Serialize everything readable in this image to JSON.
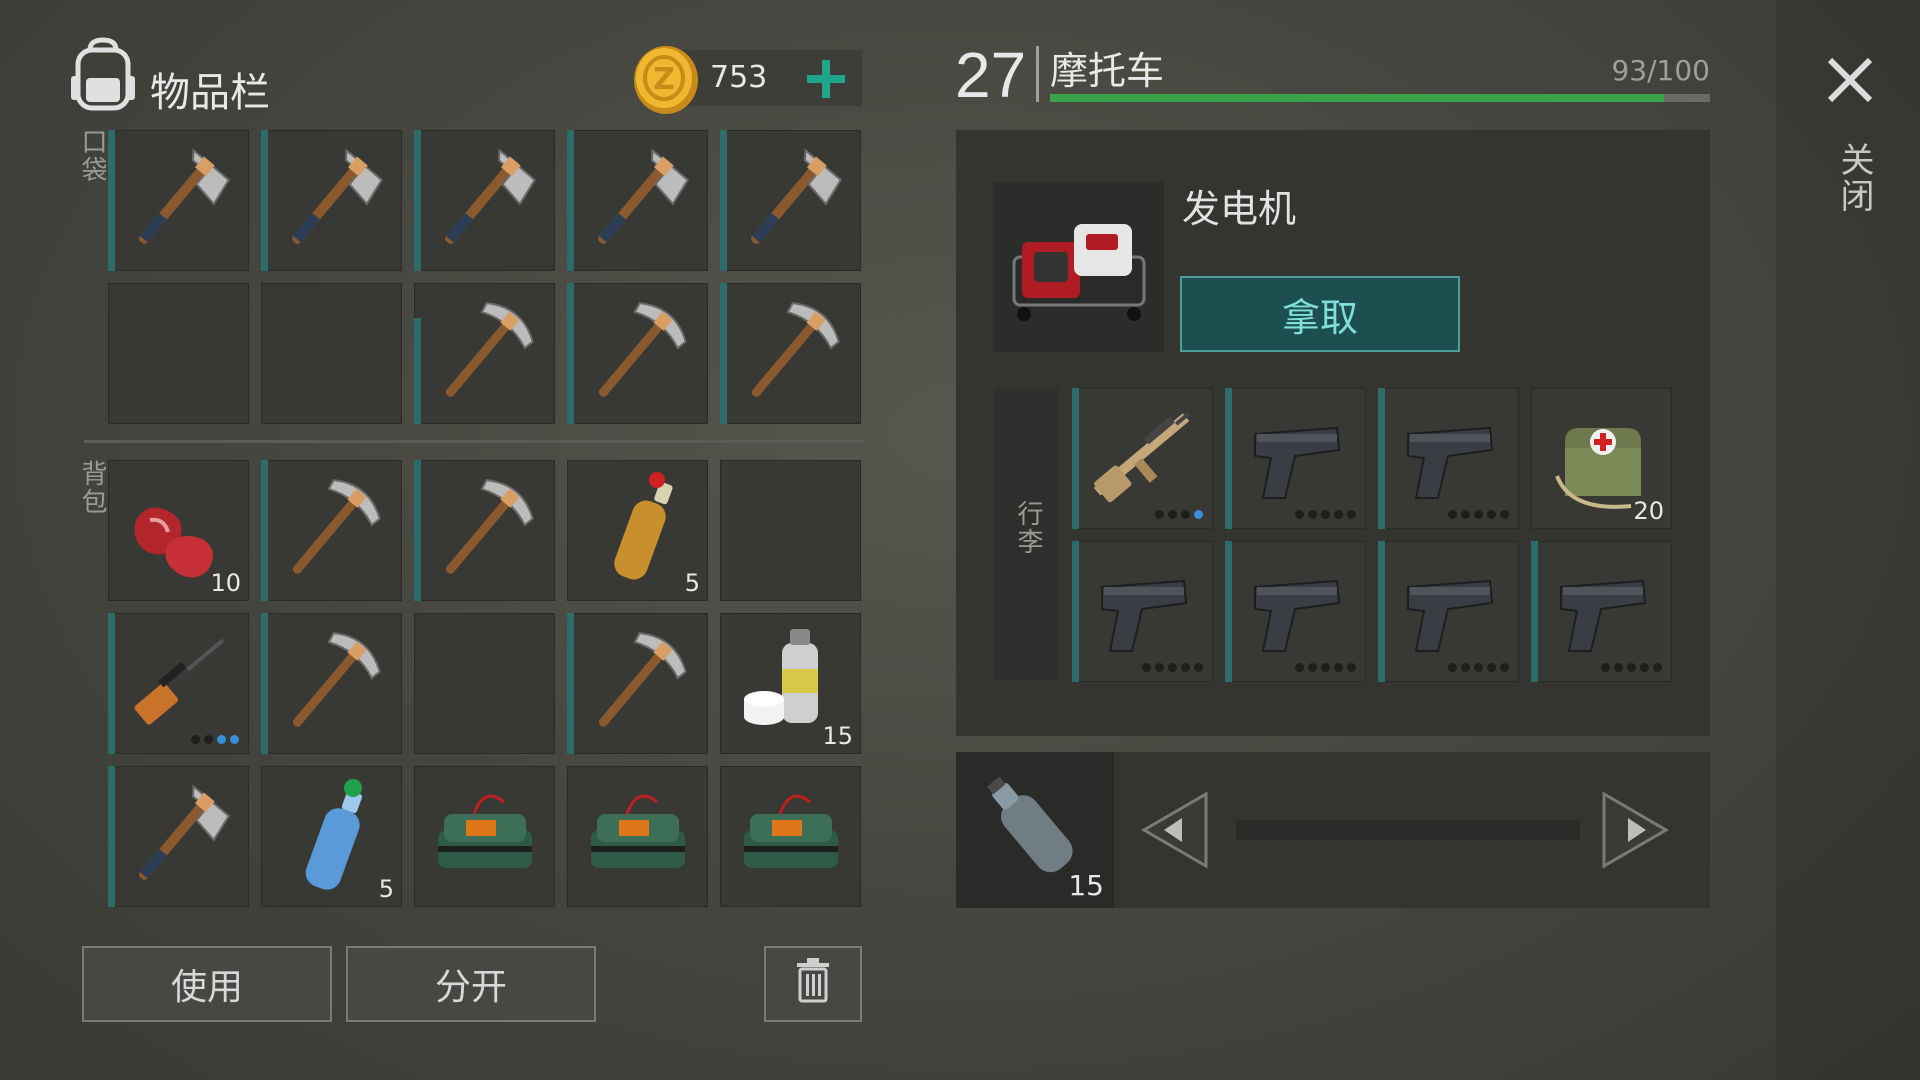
{
  "inventory": {
    "title": "物品栏",
    "backpack_icon": "backpack-icon",
    "currency": {
      "icon": "coin-icon",
      "amount": "753",
      "add_icon": "plus-icon"
    },
    "pockets_label": "口袋",
    "bag_label": "背包",
    "pocket_slots": [
      {
        "item": "hatchet-icon",
        "durability": 1.0
      },
      {
        "item": "hatchet-icon",
        "durability": 1.0
      },
      {
        "item": "hatchet-icon",
        "durability": 1.0
      },
      {
        "item": "hatchet-icon",
        "durability": 1.0
      },
      {
        "item": "hatchet-icon",
        "durability": 1.0
      },
      {
        "item": "",
        "durability": 0
      },
      {
        "item": "",
        "durability": 0
      },
      {
        "item": "pickaxe-icon",
        "durability": 0.75
      },
      {
        "item": "pickaxe-icon",
        "durability": 1.0
      },
      {
        "item": "pickaxe-icon",
        "durability": 1.0
      }
    ],
    "bag_slots": [
      {
        "item": "raw-meat-icon",
        "count": "10"
      },
      {
        "item": "pickaxe-icon",
        "durability": 1.0
      },
      {
        "item": "pickaxe-icon",
        "durability": 1.0
      },
      {
        "item": "fuel-bottle-icon",
        "count": "5"
      },
      {
        "item": ""
      },
      {
        "item": "sniper-rifle-icon",
        "durability": 1.0,
        "dots": [
          0,
          0,
          1,
          1
        ]
      },
      {
        "item": "pickaxe-icon",
        "durability": 1.0
      },
      {
        "item": ""
      },
      {
        "item": "pickaxe-icon",
        "durability": 1.0
      },
      {
        "item": "spray-paint-icon",
        "count": "15"
      },
      {
        "item": "hatchet-icon",
        "durability": 1.0
      },
      {
        "item": "water-bottle-icon",
        "count": "5"
      },
      {
        "item": "c4-explosive-icon"
      },
      {
        "item": "c4-explosive-icon"
      },
      {
        "item": "c4-explosive-icon"
      }
    ],
    "use_label": "使用",
    "split_label": "分开",
    "trash_icon": "trash-icon"
  },
  "vehicle": {
    "level": "27",
    "name": "摩托车",
    "capacity_text": "93/100",
    "capacity_fraction": 0.93,
    "generator": {
      "name": "发电机",
      "icon": "generator-icon",
      "take_label": "拿取"
    },
    "trunk_label": "行李",
    "trunk_slots": [
      {
        "item": "assault-rifle-icon",
        "durability": 1.0,
        "dots": [
          0,
          0,
          0,
          1
        ]
      },
      {
        "item": "pistol-icon",
        "durability": 1.0,
        "dots": [
          0,
          0,
          0,
          0,
          0
        ]
      },
      {
        "item": "pistol-icon",
        "durability": 1.0,
        "dots": [
          0,
          0,
          0,
          0,
          0
        ]
      },
      {
        "item": "medkit-bag-icon",
        "count": "20"
      },
      {
        "item": "pistol-icon",
        "durability": 1.0,
        "dots": [
          0,
          0,
          0,
          0,
          0
        ]
      },
      {
        "item": "pistol-icon",
        "durability": 1.0,
        "dots": [
          0,
          0,
          0,
          0,
          0
        ]
      },
      {
        "item": "pistol-icon",
        "durability": 1.0,
        "dots": [
          0,
          0,
          0,
          0,
          0
        ]
      },
      {
        "item": "pistol-icon",
        "durability": 1.0,
        "dots": [
          0,
          0,
          0,
          0,
          0
        ]
      }
    ],
    "fuel": {
      "icon": "empty-bottle-icon",
      "count": "15",
      "prev_icon": "arrow-left-icon",
      "next_icon": "arrow-right-icon",
      "fill_fraction": 0.0
    }
  },
  "close": {
    "icon": "close-icon",
    "label": "关闭"
  },
  "colors": {
    "accent_teal": "#2d6c6a",
    "capacity_green": "#3aa34a",
    "take_button": "#1d4f50",
    "dot_blue": "#3a8fd8"
  }
}
